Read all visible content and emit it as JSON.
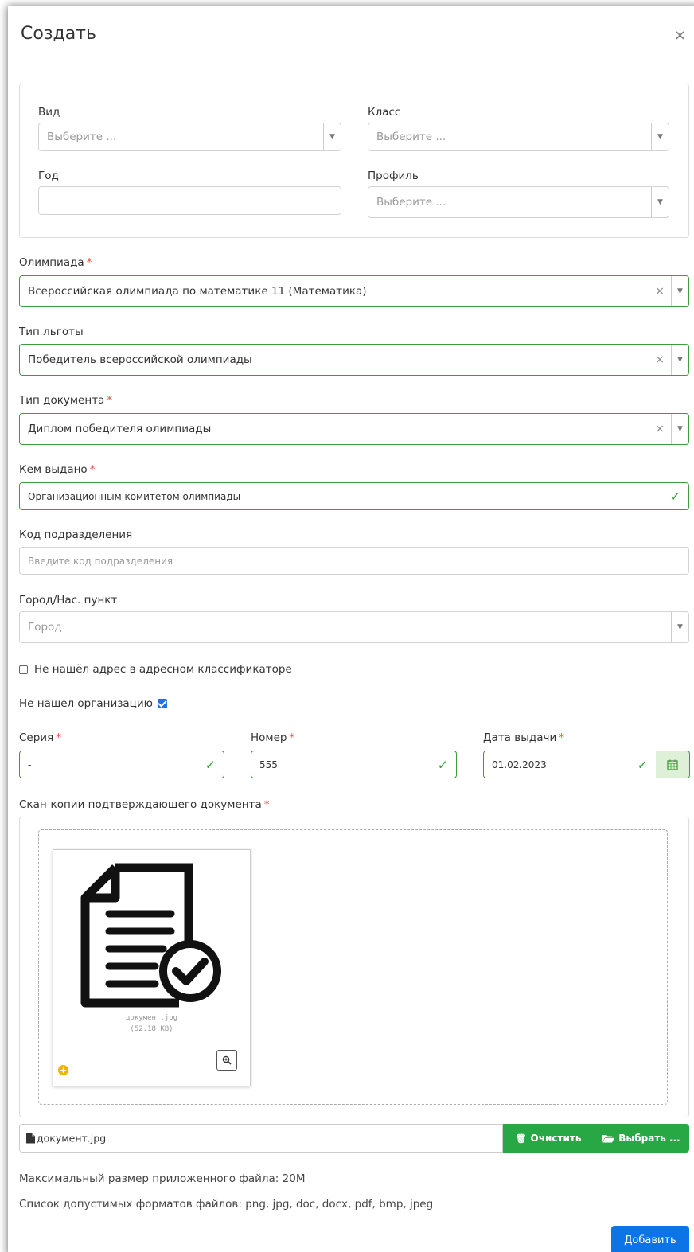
{
  "dialog": {
    "title": "Создать",
    "close": "×"
  },
  "filters": {
    "vid": {
      "label": "Вид",
      "placeholder": "Выберите ..."
    },
    "klass": {
      "label": "Класс",
      "placeholder": "Выберите ..."
    },
    "god": {
      "label": "Год",
      "value": ""
    },
    "profil": {
      "label": "Профиль",
      "placeholder": "Выберите ..."
    }
  },
  "olympiad": {
    "label": "Олимпиада",
    "required": "*",
    "value": "Всероссийская олимпиада по математике 11 (Математика)"
  },
  "benefit_type": {
    "label": "Тип льготы",
    "value": "Победитель всероссийской олимпиады"
  },
  "doc_type": {
    "label": "Тип документа",
    "required": "*",
    "value": "Диплом победителя олимпиады"
  },
  "issued_by": {
    "label": "Кем выдано",
    "required": "*",
    "value": "Организационным комитетом олимпиады"
  },
  "division_code": {
    "label": "Код подразделения",
    "placeholder": "Введите код подразделения"
  },
  "city": {
    "label": "Город/Нас. пункт",
    "placeholder": "Город"
  },
  "address_not_found": {
    "label": "Не нашёл адрес в адресном классификаторе",
    "checked": false
  },
  "org_not_found": {
    "label": "Не нашел организацию",
    "checked": true
  },
  "series": {
    "label": "Серия",
    "required": "*",
    "value": "-"
  },
  "number": {
    "label": "Номер",
    "required": "*",
    "value": "555"
  },
  "issue_date": {
    "label": "Дата выдачи",
    "required": "*",
    "value": "01.02.2023"
  },
  "scans": {
    "label": "Скан-копии подтверждающего документа",
    "required": "*",
    "file_name": "документ.jpg",
    "file_size": "(52.18 KB)",
    "clear_label": "Очистить",
    "choose_label": "Выбрать ..."
  },
  "info": {
    "max_size": "Максимальный размер приложенного файла: 20M",
    "formats": "Список допустимых форматов файлов: png, jpg, doc, docx, pdf, bmp, jpeg"
  },
  "submit_label": "Добавить",
  "icons": {
    "check": "✓",
    "clear": "×",
    "caret": "▼"
  },
  "colors": {
    "success": "#3c9d3c",
    "primary": "#0d74e7",
    "required": "#e74c3c",
    "button_green": "#28a745"
  }
}
